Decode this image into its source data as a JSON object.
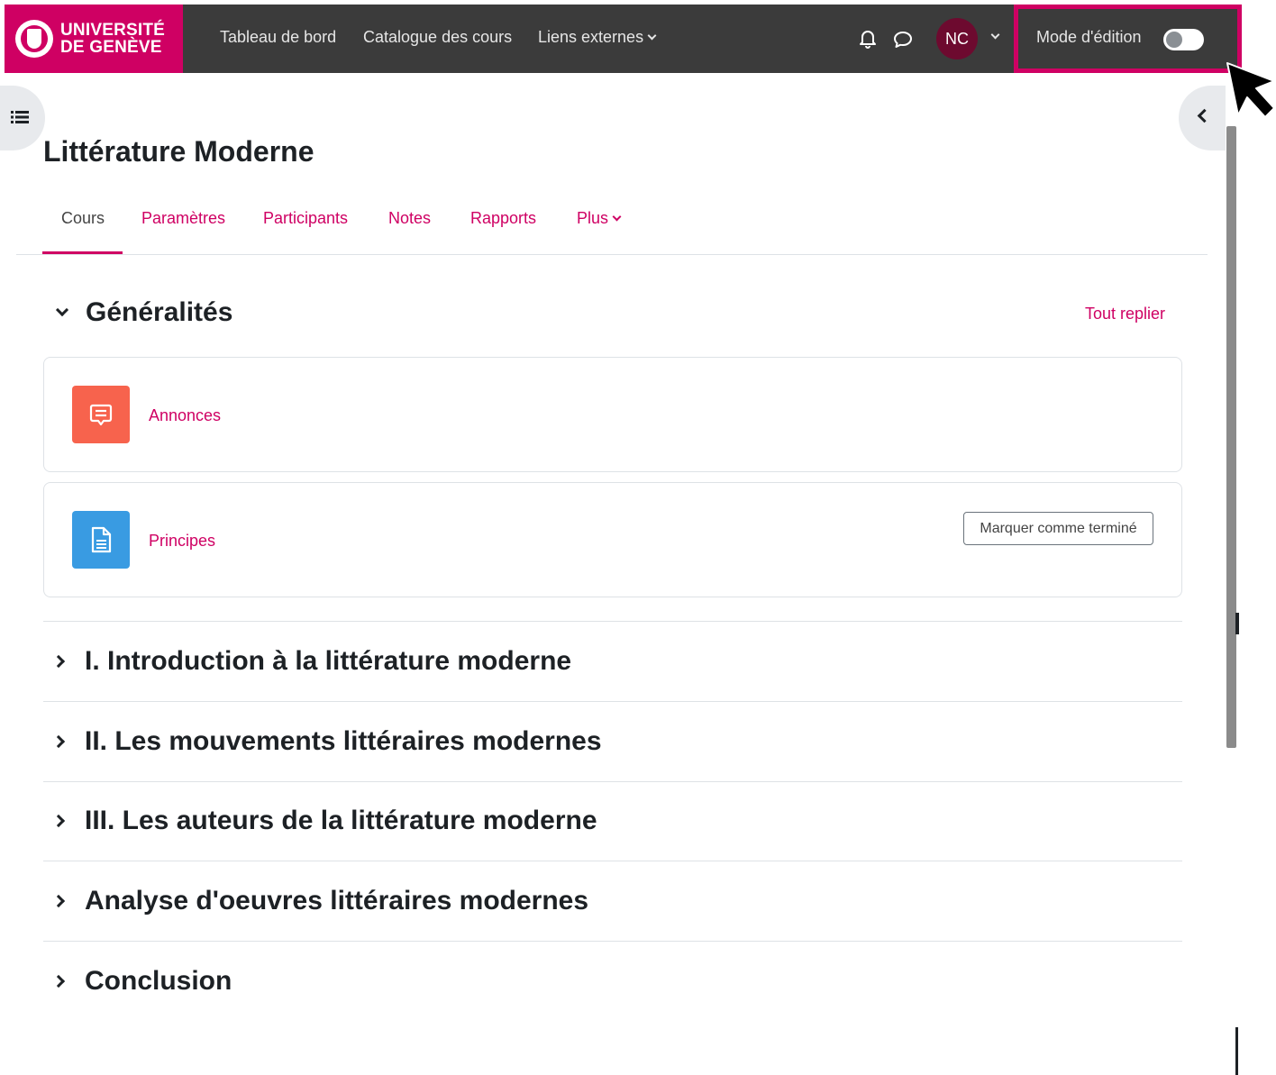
{
  "navbar": {
    "logo_line1": "UNIVERSITÉ",
    "logo_line2": "DE GENÈVE",
    "links": [
      "Tableau de bord",
      "Catalogue des cours",
      "Liens externes"
    ],
    "avatar_initials": "NC",
    "edit_mode_label": "Mode d'édition",
    "edit_mode_on": false,
    "bg_color": "#3b3b3b",
    "brand_color": "#cf0063"
  },
  "course": {
    "title": "Littérature Moderne",
    "tabs": [
      "Cours",
      "Paramètres",
      "Participants",
      "Notes",
      "Rapports",
      "Plus"
    ],
    "active_tab": "Cours"
  },
  "general_section": {
    "title": "Généralités",
    "collapse_all_label": "Tout replier",
    "activities": [
      {
        "name": "Annonces",
        "icon": "forum-icon",
        "icon_color": "#f7634d"
      },
      {
        "name": "Principes",
        "icon": "page-icon",
        "icon_color": "#399be2",
        "button": "Marquer comme terminé"
      }
    ]
  },
  "sections": [
    "I. Introduction à la littérature moderne",
    "II. Les mouvements littéraires modernes",
    "III. Les auteurs de la littérature moderne",
    "Analyse d'oeuvres littéraires modernes",
    "Conclusion"
  ]
}
